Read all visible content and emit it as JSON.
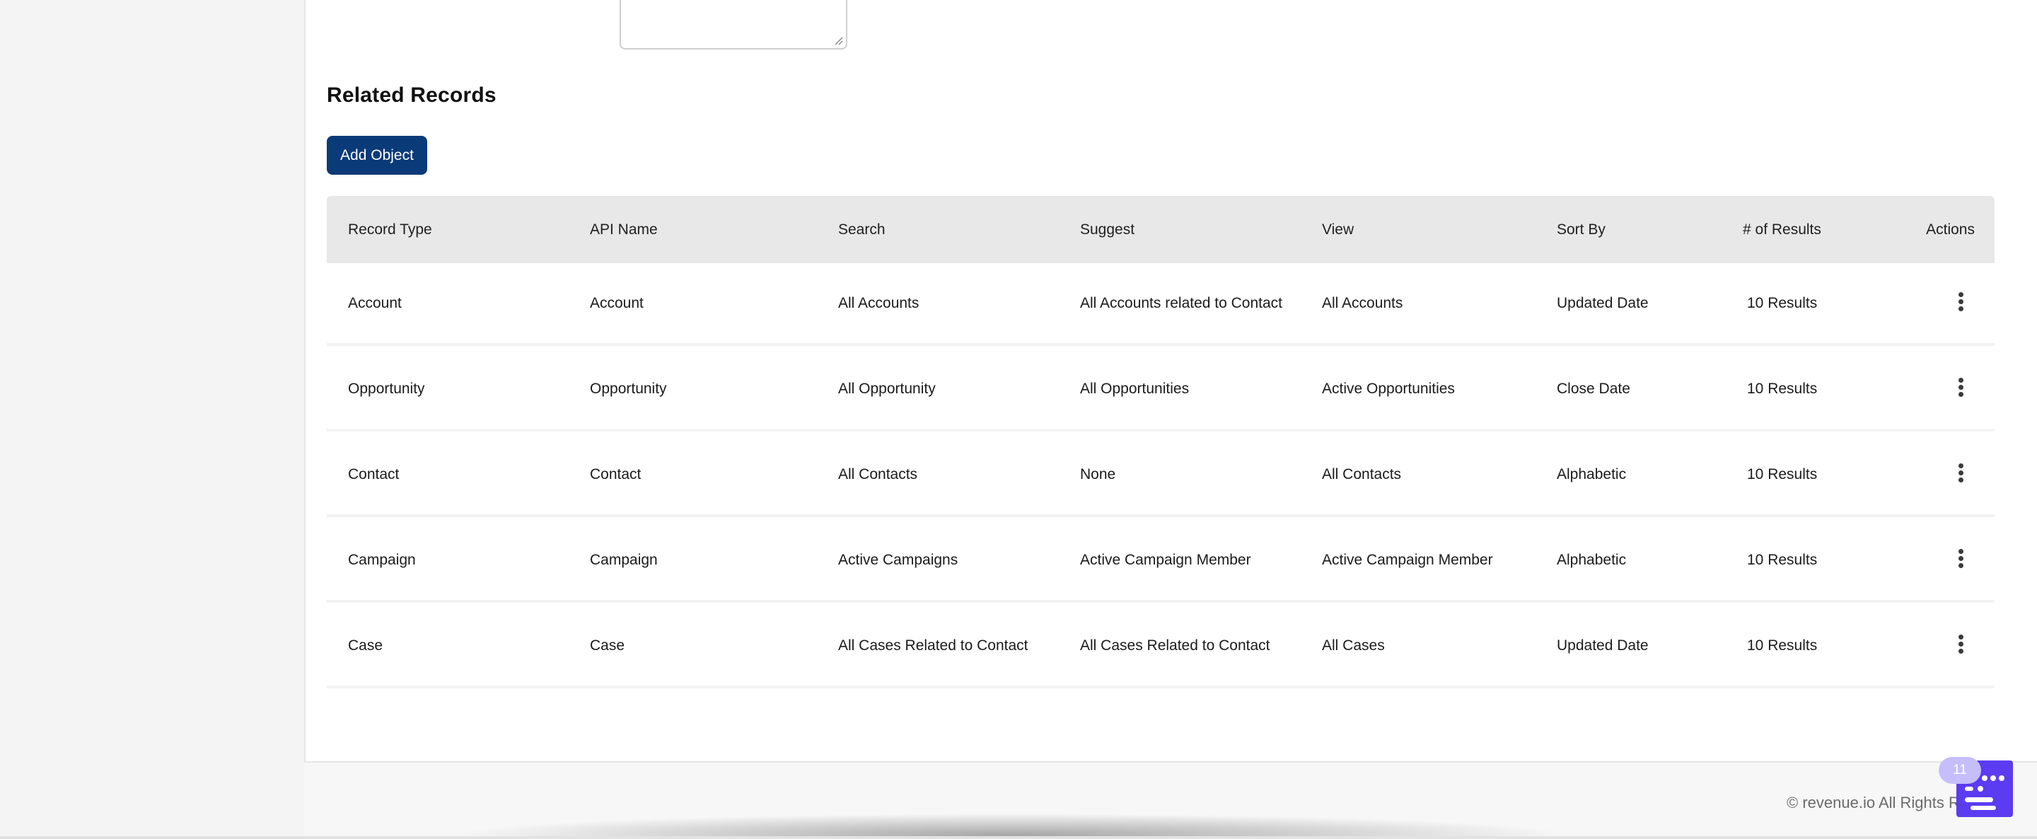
{
  "section": {
    "title": "Related Records",
    "add_button": "Add Object"
  },
  "table": {
    "headers": [
      "Record Type",
      "API Name",
      "Search",
      "Suggest",
      "View",
      "Sort By",
      "# of Results",
      "Actions"
    ],
    "rows": [
      {
        "record_type": "Account",
        "api_name": "Account",
        "search": "All Accounts",
        "suggest": "All Accounts related to Contact",
        "view": "All Accounts",
        "sort_by": "Updated Date",
        "results": "10 Results"
      },
      {
        "record_type": "Opportunity",
        "api_name": "Opportunity",
        "search": "All Opportunity",
        "suggest": "All Opportunities",
        "view": "Active Opportunities",
        "sort_by": "Close Date",
        "results": "10 Results"
      },
      {
        "record_type": "Contact",
        "api_name": "Contact",
        "search": "All Contacts",
        "suggest": "None",
        "view": "All Contacts",
        "sort_by": "Alphabetic",
        "results": "10 Results"
      },
      {
        "record_type": "Campaign",
        "api_name": "Campaign",
        "search": "Active Campaigns",
        "suggest": "Active Campaign Member",
        "view": "Active Campaign Member",
        "sort_by": "Alphabetic",
        "results": "10 Results"
      },
      {
        "record_type": "Case",
        "api_name": "Case",
        "search": "All Cases Related to Contact",
        "suggest": "All Cases Related to Contact",
        "view": "All Cases",
        "sort_by": "Updated Date",
        "results": "10 Results"
      }
    ],
    "row_action_icon": "kebab-menu-icon"
  },
  "footer": {
    "copyright": "© revenue.io All Rights R"
  },
  "chat_widget": {
    "badge_count": "11",
    "icon": "chat-widget-icon"
  },
  "colors": {
    "primary_button": "#0b3a78",
    "table_header_bg": "#e8e8e8",
    "chat_widget": "#5b3cf0",
    "chat_badge": "#c6bdfb"
  }
}
